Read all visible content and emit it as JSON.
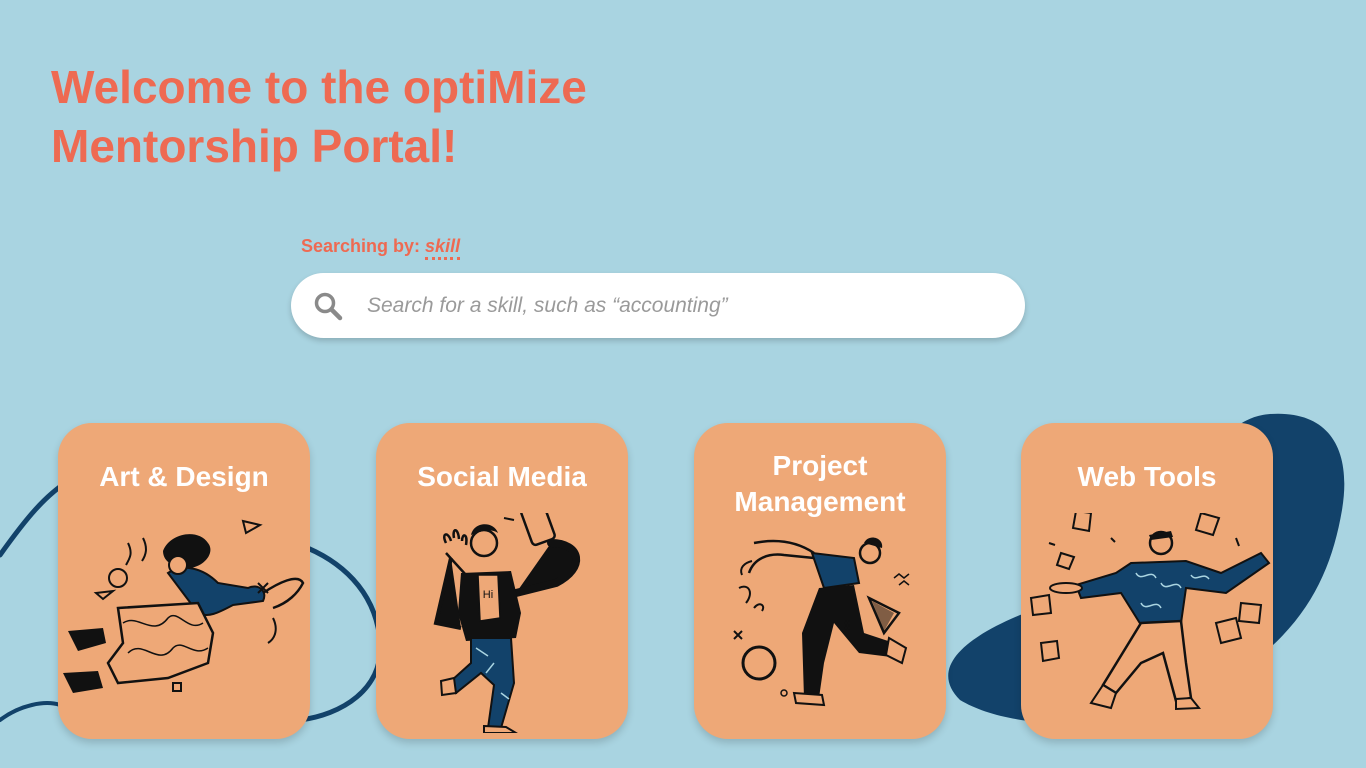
{
  "header": {
    "title_line1": "Welcome to the optiMize",
    "title_line2": "Mentorship Portal!"
  },
  "search": {
    "mode_label": "Searching by:",
    "mode_value": "skill",
    "placeholder": "Search for a skill, such as “accounting”",
    "icon": "search-icon"
  },
  "categories": [
    {
      "label": "Art & Design",
      "illustration": "falling-artist-illustration"
    },
    {
      "label": "Social Media",
      "illustration": "selfie-person-illustration"
    },
    {
      "label": "Project Management",
      "label_line1": "Project",
      "label_line2": "Management",
      "illustration": "juggling-shapes-illustration"
    },
    {
      "label": "Web Tools",
      "illustration": "flying-papers-illustration"
    }
  ],
  "colors": {
    "background": "#a9d4e1",
    "accent": "#ee6a52",
    "card": "#eea877",
    "navy": "#12426a"
  }
}
